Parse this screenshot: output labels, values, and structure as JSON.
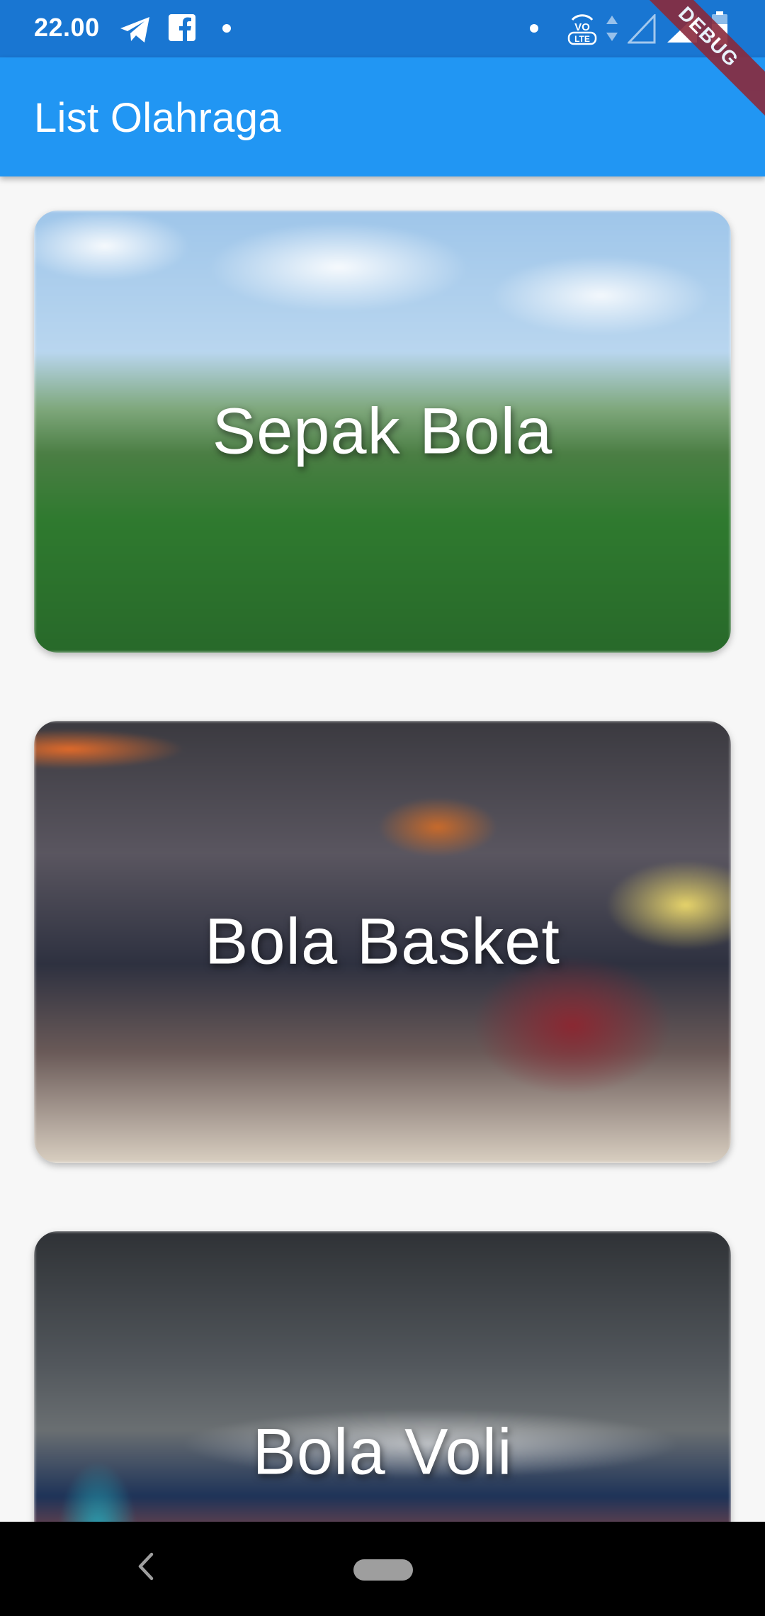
{
  "status_bar": {
    "time": "22.00",
    "left_icons": [
      "telegram-icon",
      "facebook-icon",
      "notification-dot-icon"
    ],
    "right_icons": [
      "notification-dot-icon",
      "volte-icon",
      "data-arrows-icon",
      "signal-icon",
      "wifi-icon",
      "battery-icon"
    ],
    "volte_label": "Vo\nLTE"
  },
  "app_bar": {
    "title": "List Olahraga",
    "color": "#2196f3"
  },
  "debug_banner": "DEBUG",
  "sports": [
    {
      "title": "Sepak Bola",
      "image": "soccer-photo"
    },
    {
      "title": "Bola Basket",
      "image": "basketball-photo"
    },
    {
      "title": "Bola Voli",
      "image": "volleyball-photo"
    }
  ],
  "nav_bar": {
    "back_icon": "back-chevron-icon",
    "home_icon": "home-pill-icon"
  }
}
